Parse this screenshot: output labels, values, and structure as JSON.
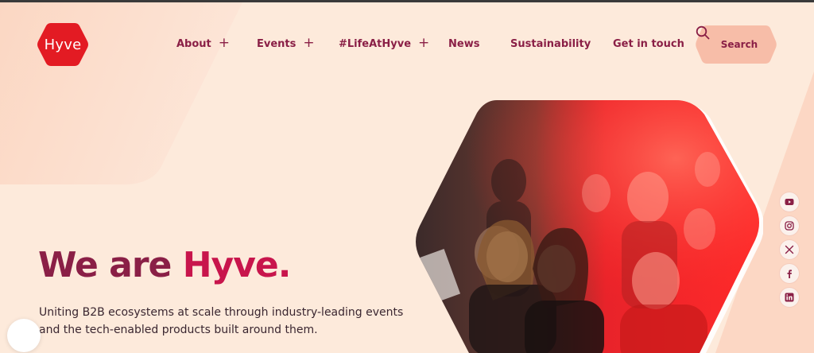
{
  "brand": {
    "logo_text": "Hyve",
    "logo_color": "#e31b23"
  },
  "nav": {
    "items": [
      {
        "label": "About",
        "expandable": true
      },
      {
        "label": "Events",
        "expandable": true
      },
      {
        "label": "#LifeAtHyve",
        "expandable": true
      },
      {
        "label": "News",
        "expandable": false
      },
      {
        "label": "Sustainability",
        "expandable": false
      },
      {
        "label": "Get in touch",
        "expandable": false
      }
    ],
    "expand_symbol": "+",
    "search_label": "Search"
  },
  "hero": {
    "title_part1": "We are",
    "title_part2": "Hyve.",
    "subtitle": "Uniting B2B ecosystems at scale through industry-leading events and the tech-enabled products built around them.",
    "image_icon": "audience-photo"
  },
  "social": [
    {
      "icon": "youtube-icon"
    },
    {
      "icon": "instagram-icon"
    },
    {
      "icon": "x-icon"
    },
    {
      "icon": "facebook-icon"
    },
    {
      "icon": "linkedin-icon"
    }
  ],
  "colors": {
    "background": "#fdeadb",
    "primary": "#8a1f46",
    "accent": "#c8154c",
    "search_bg": "#f7bda8",
    "shape_light": "#fbd9c7"
  }
}
